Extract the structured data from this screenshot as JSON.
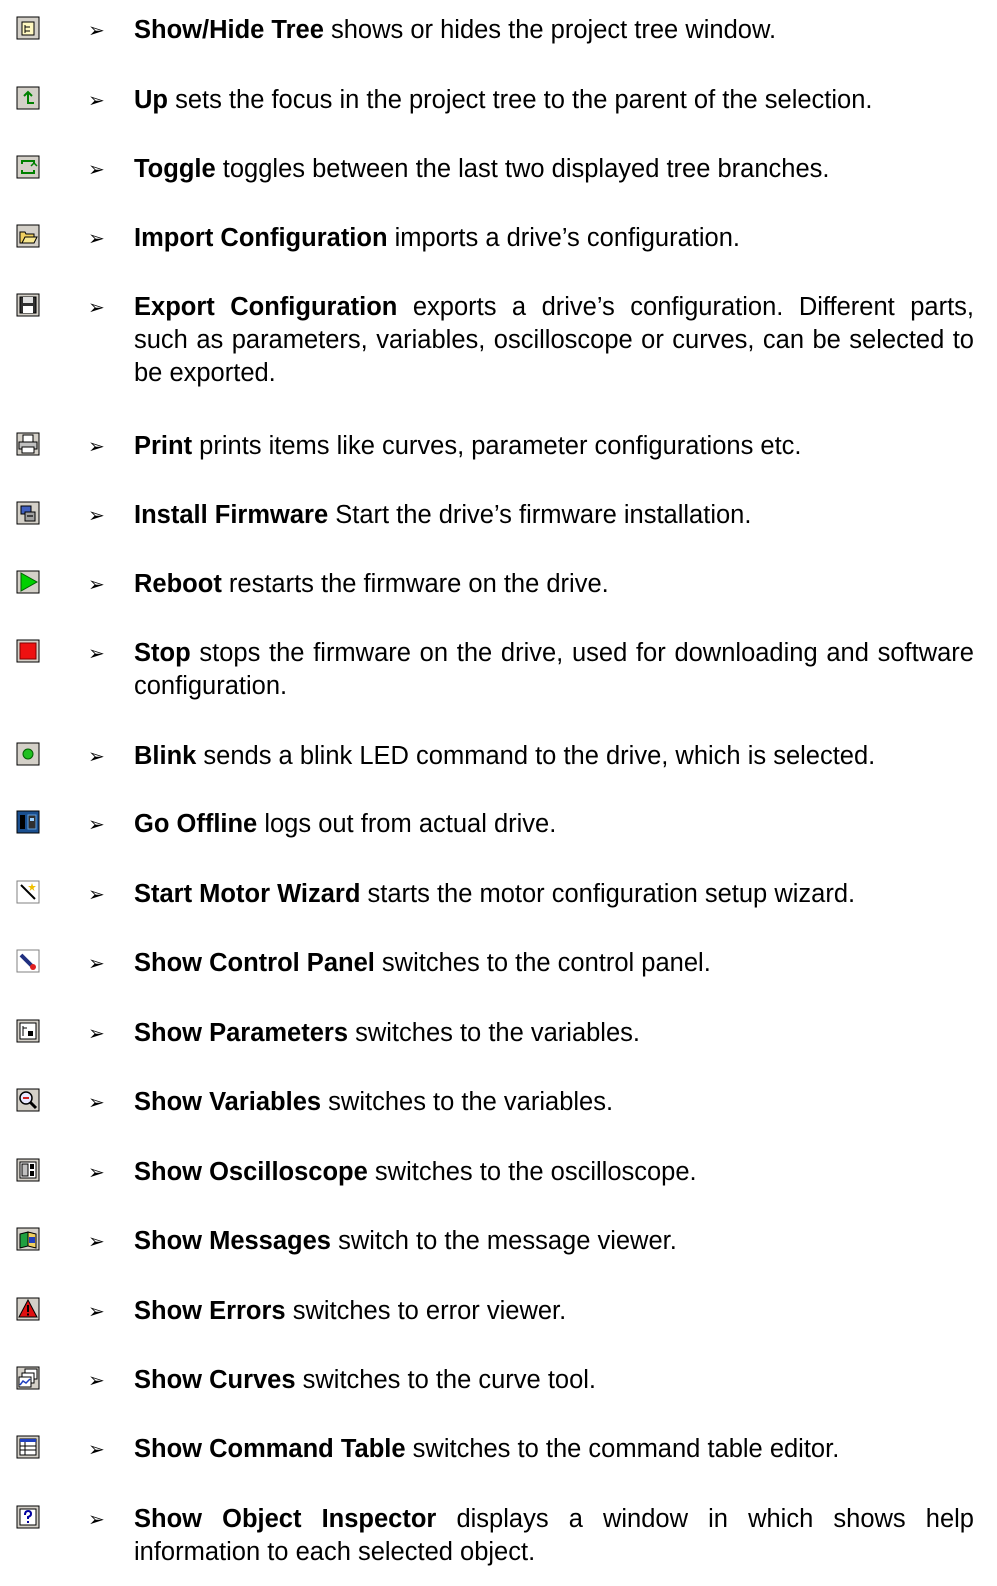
{
  "bullet_glyph": "➢",
  "entries": [
    {
      "icon": "show-hide-tree-icon",
      "bold": "Show/Hide Tree",
      "rest": " shows or hides the project tree window."
    },
    {
      "icon": "up-arrow-icon",
      "bold": "Up",
      "rest": " sets the focus in the project tree to the parent of the selection."
    },
    {
      "icon": "toggle-icon",
      "bold": "Toggle",
      "rest": " toggles between the last two displayed tree branches."
    },
    {
      "icon": "open-folder-icon",
      "bold": "Import Configuration",
      "rest": " imports a drive’s configuration."
    },
    {
      "icon": "floppy-disk-icon",
      "bold": "Export Configuration",
      "rest": " exports a drive’s configuration. Different parts, such as parameters, variables, oscilloscope or curves, can be selected to be exported."
    },
    {
      "icon": "printer-icon",
      "bold": "Print",
      "rest": " prints items like curves, parameter configurations etc."
    },
    {
      "icon": "install-firmware-icon",
      "bold": "Install Firmware",
      "rest": " Start the drive’s firmware installation."
    },
    {
      "icon": "play-icon",
      "bold": "Reboot",
      "rest": " restarts the firmware on the drive."
    },
    {
      "icon": "stop-icon",
      "bold": "Stop",
      "rest": " stops the firmware on the drive, used for downloading    and software configuration."
    },
    {
      "icon": "blink-led-icon",
      "bold": "Blink",
      "rest": " sends a blink LED command to the drive, which is selected."
    },
    {
      "icon": "go-offline-icon",
      "bold": "Go Offline",
      "rest": " logs out from actual drive."
    },
    {
      "icon": "magic-wand-icon",
      "bold": "Start Motor Wizard",
      "rest": " starts the motor configuration setup wizard."
    },
    {
      "icon": "control-panel-icon",
      "bold": "Show Control Panel",
      "rest": " switches to the control panel."
    },
    {
      "icon": "parameters-icon",
      "bold": "Show Parameters",
      "rest": " switches to the variables."
    },
    {
      "icon": "variables-icon",
      "bold": "Show Variables",
      "rest": " switches to the variables."
    },
    {
      "icon": "oscilloscope-icon",
      "bold": "Show Oscilloscope",
      "rest": " switches to the oscilloscope."
    },
    {
      "icon": "messages-icon",
      "bold": "Show Messages",
      "rest": " switch to the message viewer."
    },
    {
      "icon": "warning-icon",
      "bold": "Show Errors",
      "rest": " switches to error viewer."
    },
    {
      "icon": "curves-icon",
      "bold": "Show Curves",
      "rest": " switches to the curve tool."
    },
    {
      "icon": "command-table-icon",
      "bold": "Show Command Table",
      "rest": " switches to the command table editor."
    },
    {
      "icon": "help-icon",
      "bold": "Show Object Inspector",
      "rest": " displays a window in which shows help information to each selected object."
    }
  ]
}
